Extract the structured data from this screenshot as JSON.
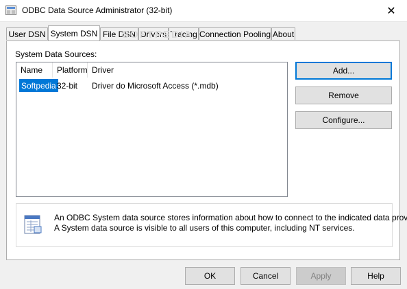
{
  "window": {
    "title": "ODBC Data Source Administrator (32-bit)",
    "close_label": "✕"
  },
  "tabs": [
    {
      "label": "User DSN"
    },
    {
      "label": "System DSN"
    },
    {
      "label": "File DSN"
    },
    {
      "label": "Drivers"
    },
    {
      "label": "Tracing"
    },
    {
      "label": "Connection Pooling"
    },
    {
      "label": "About"
    }
  ],
  "active_tab": "System DSN",
  "panel": {
    "list_label": "System Data Sources:",
    "columns": [
      "Name",
      "Platform",
      "Driver"
    ],
    "rows": [
      {
        "name": "Softpedia",
        "platform": "32-bit",
        "driver": "Driver do Microsoft Access (*.mdb)",
        "selected": true
      }
    ],
    "buttons": {
      "add": "Add...",
      "remove": "Remove",
      "configure": "Configure..."
    },
    "info": {
      "line1": "An ODBC System data source stores information about how to connect to the indicated data provider.",
      "line2": "A System data source is visible to all users of this computer, including NT services."
    }
  },
  "footer": {
    "ok": "OK",
    "cancel": "Cancel",
    "apply": "Apply",
    "help": "Help"
  },
  "watermark": "SOFTPEDIA",
  "colors": {
    "selection": "#0078d7",
    "default_button_border": "#0078d7"
  }
}
